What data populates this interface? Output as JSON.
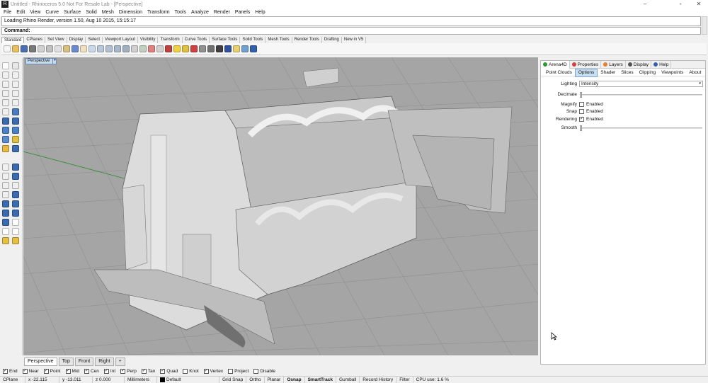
{
  "window": {
    "title": "Untitled - Rhinoceros 5.0 Not For Resale Lab - [Perspective]",
    "app_icon": "rhino-logo-icon"
  },
  "menu": [
    "File",
    "Edit",
    "View",
    "Curve",
    "Surface",
    "Solid",
    "Mesh",
    "Dimension",
    "Transform",
    "Tools",
    "Analyze",
    "Render",
    "Panels",
    "Help"
  ],
  "command": {
    "history": "Loading Rhino Render, version 1.50, Aug 10 2015, 15:15:17",
    "prompt": "Command:"
  },
  "toolbar_tabs": [
    "Standard",
    "CPlanes",
    "Set View",
    "Display",
    "Select",
    "Viewport Layout",
    "Visibility",
    "Transform",
    "Curve Tools",
    "Surface Tools",
    "Solid Tools",
    "Mesh Tools",
    "Render Tools",
    "Drafting",
    "New in V5"
  ],
  "active_toolbar_tab": "Standard",
  "viewport": {
    "label": "Perspective",
    "menu_arrow": "▾",
    "tabs": [
      "Perspective",
      "Top",
      "Front",
      "Right",
      "+"
    ],
    "active_tab": "Perspective",
    "bg_color": "#a5a5a5",
    "grid_color": "#8f8f8f",
    "x_axis_color": "#9c3c3c",
    "y_axis_color": "#2e8c2e"
  },
  "panel": {
    "tabs": [
      {
        "label": "Arena4D",
        "icon": "arena4d-icon"
      },
      {
        "label": "Properties",
        "icon": "properties-icon"
      },
      {
        "label": "Layers",
        "icon": "layers-icon"
      },
      {
        "label": "Display",
        "icon": "display-icon"
      },
      {
        "label": "Help",
        "icon": "help-icon"
      }
    ],
    "subtabs": [
      "Point Clouds",
      "Options",
      "Shader",
      "Slices",
      "Clipping",
      "Viewpoints",
      "About"
    ],
    "active_subtab": "Options",
    "lighting": {
      "label": "Lighting",
      "value": "Intensity"
    },
    "decimate": {
      "label": "Decimate",
      "value": 0
    },
    "magnify": {
      "label": "Magnify",
      "checkbox": "Enabled",
      "checked": false
    },
    "snap": {
      "label": "Snap",
      "checkbox": "Enabled",
      "checked": false
    },
    "rendering": {
      "label": "Rendering",
      "checkbox": "Enabled",
      "checked": true
    },
    "smooth": {
      "label": "Smooth",
      "value": 0
    }
  },
  "osnap": [
    {
      "label": "End",
      "checked": true
    },
    {
      "label": "Near",
      "checked": true
    },
    {
      "label": "Point",
      "checked": true
    },
    {
      "label": "Mid",
      "checked": true
    },
    {
      "label": "Cen",
      "checked": true
    },
    {
      "label": "Int",
      "checked": true
    },
    {
      "label": "Perp",
      "checked": true
    },
    {
      "label": "Tan",
      "checked": true
    },
    {
      "label": "Quad",
      "checked": true
    },
    {
      "label": "Knot",
      "checked": false
    },
    {
      "label": "Vertex",
      "checked": true
    },
    {
      "label": "Project",
      "checked": false
    },
    {
      "label": "Disable",
      "checked": false
    }
  ],
  "status": {
    "cplane": "CPlane",
    "x": "x -22.115",
    "y": "y -13.011",
    "z": "z 0.000",
    "units": "Millimeters",
    "layer": "Default",
    "grid_snap": "Grid Snap",
    "ortho": "Ortho",
    "planar": "Planar",
    "osnap": "Osnap",
    "smarttrack": "SmartTrack",
    "gumball": "Gumball",
    "record_history": "Record History",
    "filter": "Filter",
    "cpu": "CPU use: 1.6 %"
  }
}
